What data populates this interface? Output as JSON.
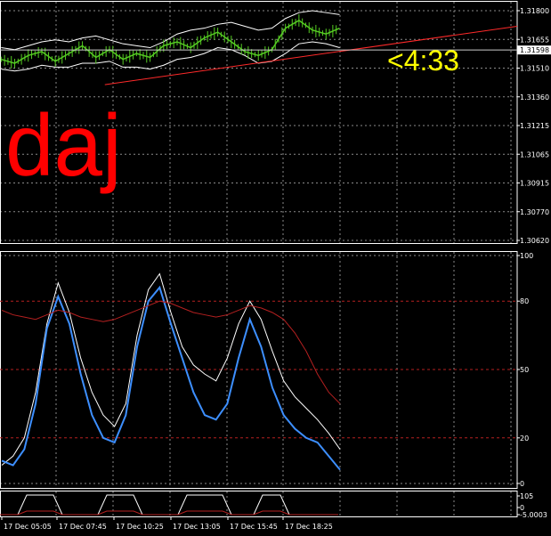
{
  "overlay": {
    "big_text": "daj",
    "timer_text": "<4:33",
    "current_price": "1.31598"
  },
  "colors": {
    "background": "#000000",
    "grid": "#8a8a8a",
    "panel_border": "#ffffff",
    "price_line": "#55cc22",
    "bands": "#ffffff",
    "trendline": "#ff2a2a",
    "big_text": "#ff0000",
    "timer": "#ffff00",
    "osc_white": "#ffffff",
    "osc_blue": "#3d8fff",
    "osc_red": "#b52020",
    "level_line": "#b52020"
  },
  "chart_data": [
    {
      "type": "line",
      "panel": "price",
      "y_ticks": [
        "1.31800",
        "1.31655",
        "1.31510",
        "1.31360",
        "1.31215",
        "1.31065",
        "1.30915",
        "1.30770",
        "1.30620"
      ],
      "ylim": [
        1.3062,
        1.318
      ],
      "grid": true,
      "x": [
        0,
        4,
        8,
        12,
        16,
        20,
        24,
        28,
        32,
        36,
        40,
        44,
        48,
        52,
        56,
        60,
        64,
        68,
        72,
        76,
        80,
        84,
        88,
        92,
        96,
        100
      ],
      "series": [
        {
          "values": [
            1.3155,
            1.3153,
            1.3157,
            1.3159,
            1.3154,
            1.3158,
            1.3162,
            1.3156,
            1.316,
            1.3155,
            1.3158,
            1.3156,
            1.3162,
            1.3164,
            1.3161,
            1.3166,
            1.3169,
            1.3164,
            1.3159,
            1.3157,
            1.316,
            1.3171,
            1.3175,
            1.317,
            1.3168,
            1.3171
          ]
        },
        {
          "values": [
            1.3161,
            1.316,
            1.3162,
            1.3164,
            1.3165,
            1.3164,
            1.3166,
            1.3167,
            1.3165,
            1.3163,
            1.3162,
            1.3161,
            1.3164,
            1.3168,
            1.317,
            1.3171,
            1.3173,
            1.3174,
            1.3172,
            1.317,
            1.3171,
            1.3176,
            1.3179,
            1.318,
            1.3179,
            1.3178
          ]
        },
        {
          "values": [
            1.315,
            1.3149,
            1.315,
            1.3152,
            1.3151,
            1.3151,
            1.3153,
            1.3153,
            1.3154,
            1.3151,
            1.3151,
            1.315,
            1.3152,
            1.3155,
            1.3156,
            1.3158,
            1.3161,
            1.316,
            1.3157,
            1.3153,
            1.3154,
            1.3158,
            1.3163,
            1.3164,
            1.3163,
            1.3161
          ]
        }
      ],
      "trendline": {
        "x": [
          28,
          100
        ],
        "y": [
          1.3142,
          1.3172
        ]
      },
      "current_price": 1.31598
    },
    {
      "type": "line",
      "panel": "oscillator",
      "y_ticks": [
        "100",
        "80",
        "50",
        "20",
        "0"
      ],
      "ylim": [
        0,
        100
      ],
      "levels": [
        80,
        50,
        20
      ],
      "grid": true,
      "x": [
        0,
        2,
        4,
        6,
        8,
        10,
        12,
        14,
        16,
        18,
        20,
        22,
        24,
        26,
        28,
        30,
        32,
        34,
        36,
        38,
        40,
        42,
        44,
        46,
        48,
        50,
        52,
        54,
        56,
        58,
        60
      ],
      "series": [
        {
          "values": [
            8,
            12,
            20,
            40,
            70,
            88,
            75,
            55,
            40,
            30,
            25,
            35,
            65,
            85,
            92,
            75,
            60,
            52,
            48,
            45,
            55,
            70,
            80,
            72,
            58,
            45,
            38,
            33,
            28,
            22,
            15
          ]
        },
        {
          "values": [
            10,
            8,
            15,
            35,
            68,
            82,
            70,
            48,
            30,
            20,
            18,
            30,
            60,
            80,
            86,
            70,
            55,
            40,
            30,
            28,
            35,
            55,
            72,
            60,
            42,
            30,
            24,
            20,
            18,
            12,
            6
          ]
        },
        {
          "values": [
            76,
            74,
            73,
            72,
            74,
            76,
            75,
            73,
            72,
            71,
            72,
            74,
            76,
            78,
            80,
            79,
            77,
            75,
            74,
            73,
            74,
            76,
            78,
            77,
            75,
            72,
            66,
            58,
            48,
            40,
            35
          ]
        }
      ]
    },
    {
      "type": "line",
      "panel": "mini",
      "y_ticks": [
        "105",
        "0",
        "-5.0003"
      ],
      "ylim": [
        -5,
        105
      ],
      "grid": true,
      "series": []
    }
  ],
  "x_axis": {
    "ticks": [
      "17 Dec 05:05",
      "17 Dec 07:45",
      "17 Dec 10:25",
      "17 Dec 13:05",
      "17 Dec 15:45",
      "17 Dec 18:25"
    ]
  }
}
